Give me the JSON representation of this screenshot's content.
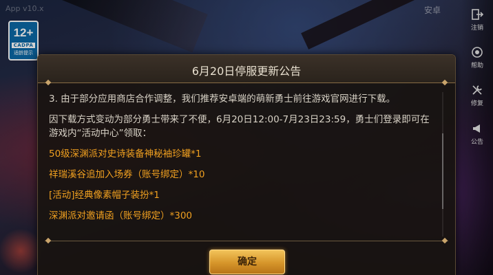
{
  "watermark": "App v10.x",
  "age_badge": {
    "age": "12+",
    "org": "CADPA",
    "tip": "适龄提示"
  },
  "top_right_label": "安卓",
  "side_menu": [
    {
      "icon": "logout-icon",
      "label": "注销"
    },
    {
      "icon": "help-icon",
      "label": "帮助"
    },
    {
      "icon": "repair-icon",
      "label": "修复"
    },
    {
      "icon": "announcement-icon",
      "label": "公告"
    }
  ],
  "dialog": {
    "title": "6月20日停服更新公告",
    "paragraphs": [
      "3. 由于部分应用商店合作调整，我们推荐安卓端的萌新勇士前往游戏官网进行下载。",
      "因下载方式变动为部分勇士带来了不便，6月20日12:00-7月23日23:59，勇士们登录即可在游戏内“活动中心”领取："
    ],
    "rewards": [
      "50级深渊派对史诗装备神秘袖珍罐*1",
      "祥瑞溪谷追加入场券（账号绑定）*10",
      "[活动]经典像素帽子装扮*1",
      "深渊派对邀请函（账号绑定）*300"
    ],
    "confirm_label": "确定"
  },
  "colors": {
    "accent_gold": "#f0a020",
    "button_gold": "#d6952a",
    "dialog_bg": "#181410",
    "text_main": "#d8d2c6"
  }
}
